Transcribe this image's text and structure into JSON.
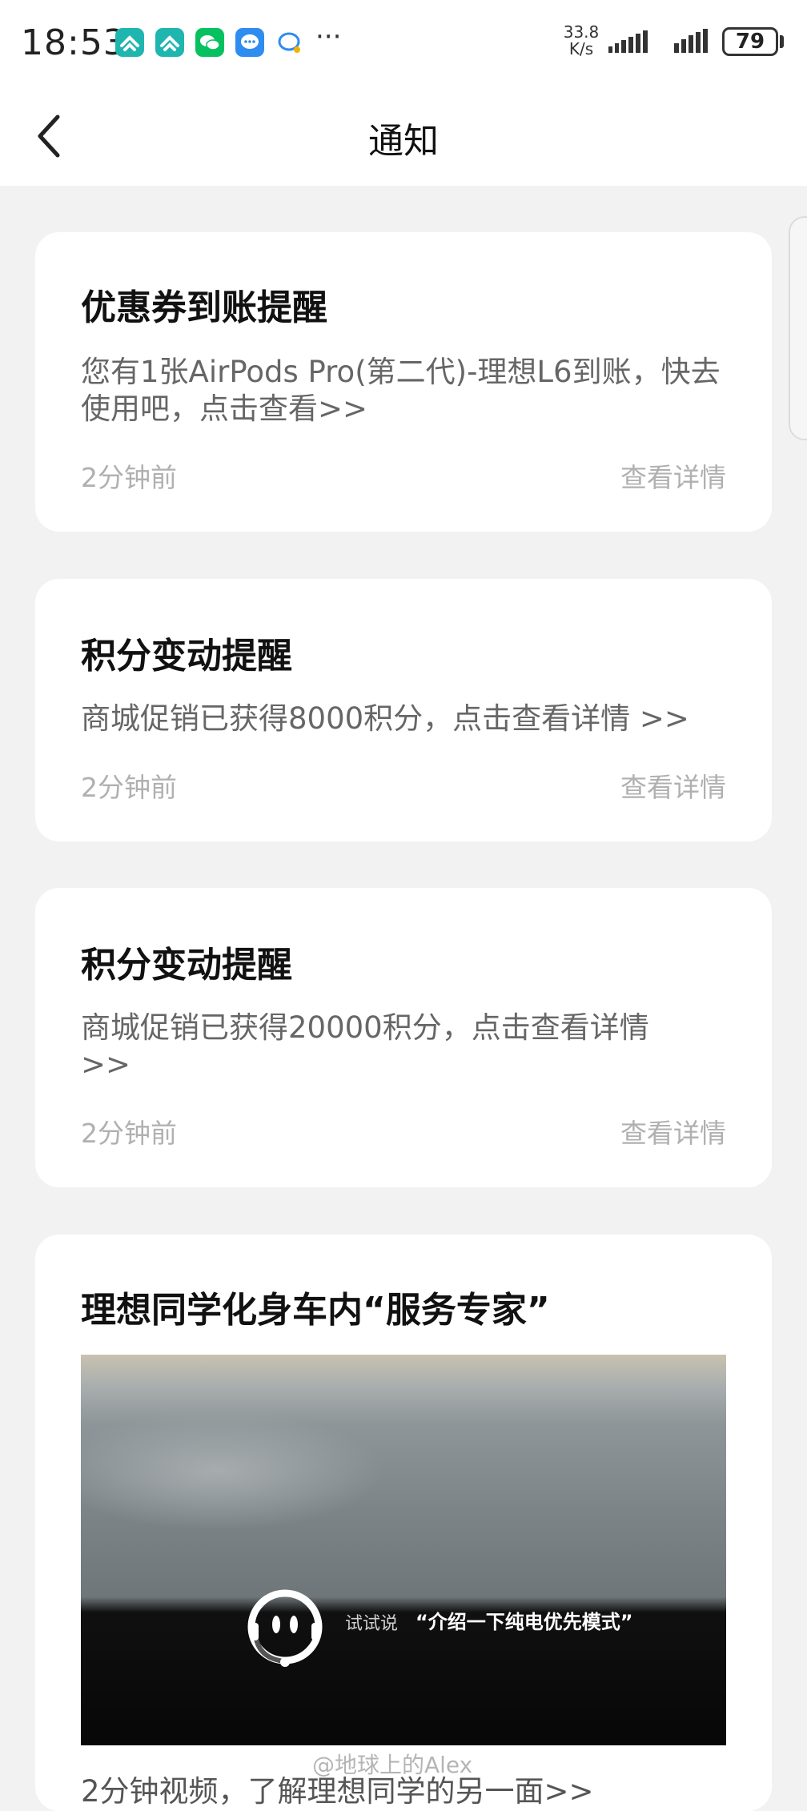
{
  "status_bar": {
    "time": "18:53",
    "app_icons": [
      "ctrip-icon",
      "ctrip-icon",
      "wechat-icon",
      "message-icon",
      "chat-bubble-icon"
    ],
    "more": "···",
    "net_speed_value": "33.8",
    "net_speed_unit": "K/s",
    "battery": "79"
  },
  "nav": {
    "title": "通知"
  },
  "notifications": [
    {
      "title": "优惠券到账提醒",
      "body": "您有1张AirPods Pro(第二代)-理想L6到账，快去使用吧，点击查看>>",
      "time": "2分钟前",
      "link": "查看详情"
    },
    {
      "title": "积分变动提醒",
      "body": "商城促销已获得8000积分，点击查看详情 >>",
      "time": "2分钟前",
      "link": "查看详情"
    },
    {
      "title": "积分变动提醒",
      "body": "商城促销已获得20000积分，点击查看详情 >>",
      "time": "2分钟前",
      "link": "查看详情"
    },
    {
      "title": "理想同学化身车内“服务专家”",
      "video_hint": "试试说",
      "video_quote": "“介绍一下纯电优先模式”",
      "subtitle": "2分钟视频，了解理想同学的另一面>>"
    }
  ],
  "watermark": "@地球上的Alex",
  "colors": {
    "background": "#f2f2f2",
    "card": "#ffffff",
    "title_text": "#111111",
    "body_text": "#666666",
    "meta_text": "#b0b0b0",
    "ctrip_teal": "#1fb6b0",
    "wechat_green": "#07c160",
    "message_blue": "#2f8cf0"
  }
}
